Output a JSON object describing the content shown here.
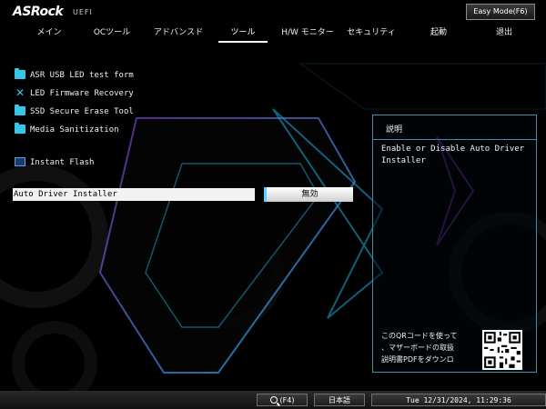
{
  "header": {
    "logo": "ASRock",
    "uefi": "UEFI",
    "easy_mode": "Easy Mode(F6)"
  },
  "menu": {
    "tabs": [
      {
        "label": "メイン"
      },
      {
        "label": "OCツール"
      },
      {
        "label": "アドバンスド"
      },
      {
        "label": "ツール",
        "active": true
      },
      {
        "label": "H/W モニター"
      },
      {
        "label": "セキュリティ"
      },
      {
        "label": "起動"
      },
      {
        "label": "退出"
      }
    ]
  },
  "tools": {
    "items": [
      {
        "label": "ASR USB LED test form",
        "icon": "folder-icon"
      },
      {
        "label": "LED Firmware Recovery",
        "icon": "tools-icon"
      },
      {
        "label": "SSD Secure Erase Tool",
        "icon": "folder-icon"
      },
      {
        "label": "Media Sanitization",
        "icon": "folder-icon"
      },
      {
        "label": "Instant Flash",
        "icon": "flash-icon"
      }
    ],
    "setting": {
      "label": "Auto Driver Installer",
      "value": "無効"
    }
  },
  "help": {
    "title": "説明",
    "text": "Enable or Disable Auto Driver Installer",
    "qr_lines": [
      "このQRコードを使って",
      "、マザーボードの取扱",
      "説明書PDFをダウンロ"
    ]
  },
  "footer": {
    "search": "(F4)",
    "language": "日本語",
    "datetime": "Tue 12/31/2024, 11:29:36"
  },
  "colors": {
    "accent": "#4fd6ff",
    "background": "#000000",
    "highlight_row": "#f2f2f2"
  }
}
